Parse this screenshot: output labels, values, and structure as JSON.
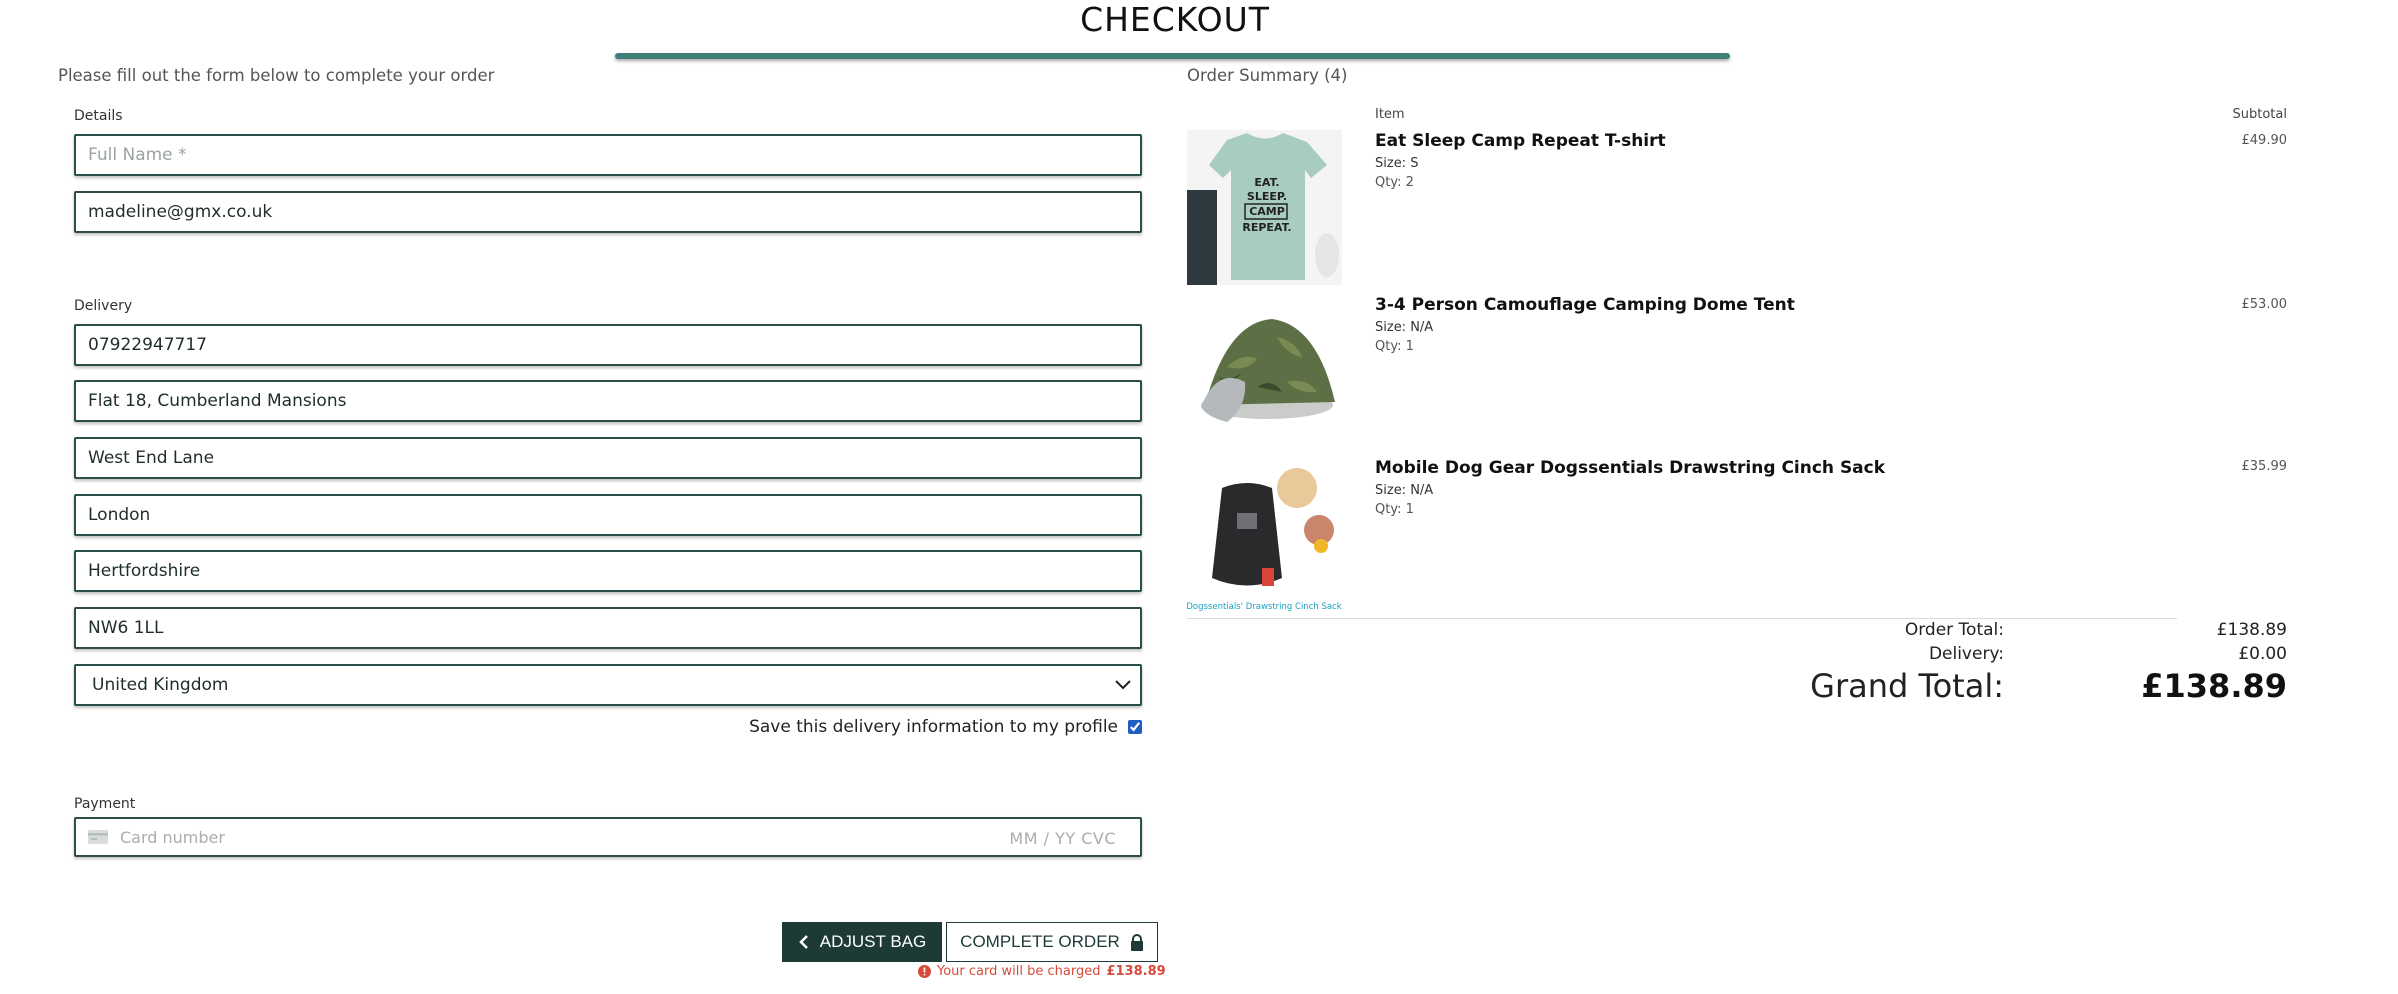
{
  "page": {
    "title": "CHECKOUT",
    "form_intro": "Please fill out the form below to complete your order"
  },
  "details": {
    "section_label": "Details",
    "full_name_placeholder": "Full Name *",
    "email": "madeline@gmx.co.uk"
  },
  "delivery": {
    "section_label": "Delivery",
    "phone": "07922947717",
    "address1": "Flat 18, Cumberland Mansions",
    "address2": "West End Lane",
    "town": "London",
    "county": "Hertfordshire",
    "postcode": "NW6 1LL",
    "country": "United Kingdom",
    "save_label": "Save this delivery information to my profile",
    "save_checked": true
  },
  "payment": {
    "section_label": "Payment",
    "card_placeholder": "Card number",
    "expiry_cvc_placeholder": "MM / YY  CVC"
  },
  "actions": {
    "adjust_label": "ADJUST BAG",
    "complete_label": "COMPLETE ORDER",
    "charge_note": "Your card will be charged",
    "charge_amount": "£138.89"
  },
  "summary": {
    "title": "Order Summary (4)",
    "col_item": "Item",
    "col_subtotal": "Subtotal",
    "items": [
      {
        "name": "Eat Sleep Camp Repeat T-shirt",
        "size": "Size: S",
        "qty": "Qty: 2",
        "subtotal": "£49.90",
        "image_text": [
          "EAT.",
          "SLEEP.",
          "CAMP",
          "REPEAT."
        ]
      },
      {
        "name": "3-4 Person Camouflage Camping Dome Tent",
        "size": "Size: N/A",
        "qty": "Qty: 1",
        "subtotal": "£53.00"
      },
      {
        "name": "Mobile Dog Gear Dogssentials Drawstring Cinch Sack",
        "size": "Size: N/A",
        "qty": "Qty: 1",
        "subtotal": "£35.99",
        "image_text": [
          "Dogssentials' Drawstring Cinch Sack"
        ]
      }
    ],
    "order_total_label": "Order Total:",
    "order_total": "£138.89",
    "delivery_label": "Delivery:",
    "delivery": "£0.00",
    "grand_total_label": "Grand Total:",
    "grand_total": "£138.89"
  },
  "colors": {
    "accent": "#3f7f77",
    "field_border": "#294f4a",
    "button_dark": "#1d3a37",
    "error": "#d64a3a"
  }
}
